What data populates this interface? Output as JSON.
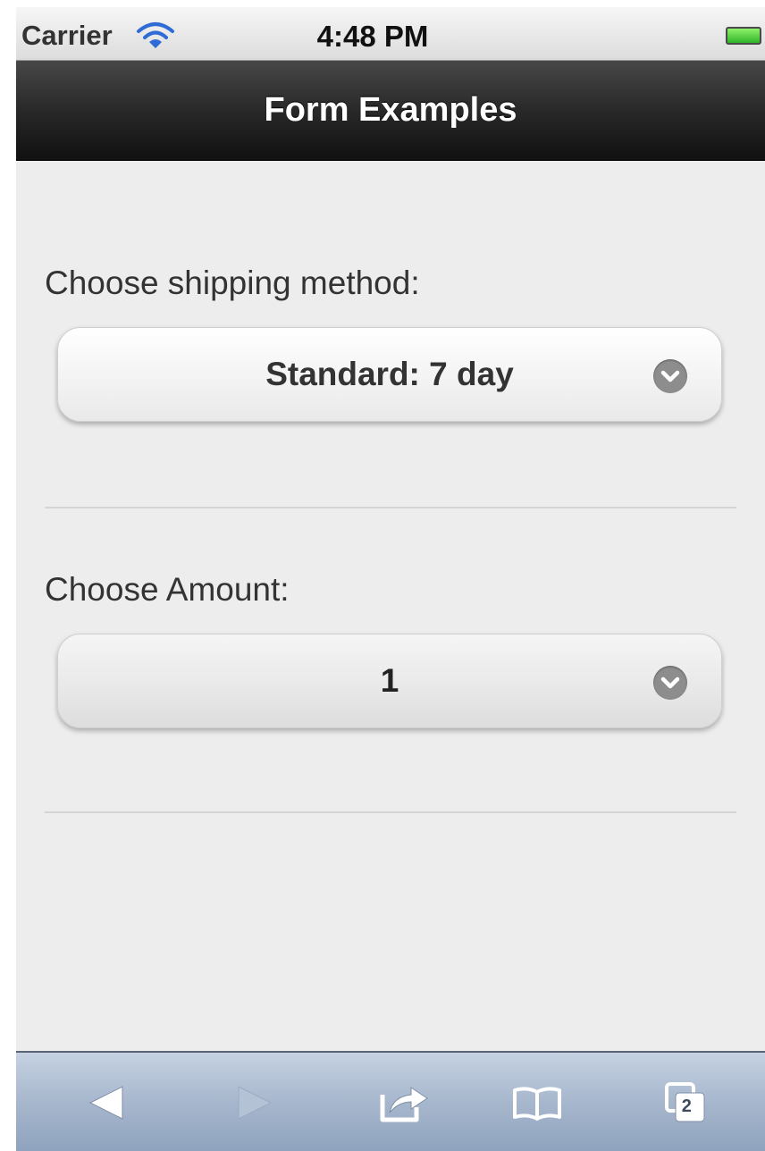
{
  "status_bar": {
    "carrier": "Carrier",
    "time": "4:48 PM"
  },
  "header": {
    "title": "Form Examples"
  },
  "form": {
    "shipping": {
      "label": "Choose shipping method:",
      "selected": "Standard: 7 day"
    },
    "amount": {
      "label": "Choose Amount:",
      "selected": "1"
    }
  },
  "toolbar": {
    "tabs_count": "2",
    "icons": [
      "back-icon",
      "forward-icon",
      "share-icon",
      "bookmarks-icon",
      "tabs-icon"
    ]
  },
  "colors": {
    "header": "#262626",
    "toolbar": "#a7b7cd",
    "content_bg": "#ededed",
    "chevron": "#8d8d8d"
  }
}
